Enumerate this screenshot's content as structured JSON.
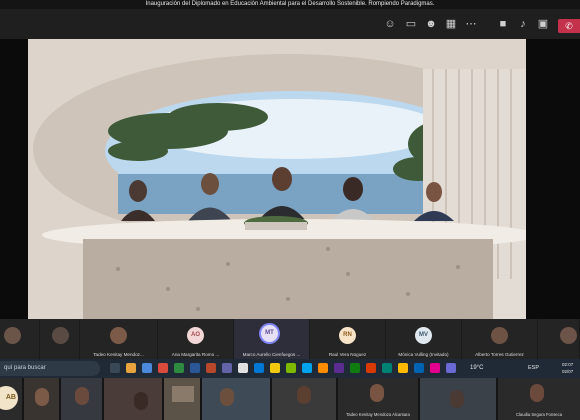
{
  "meeting": {
    "title": "Inauguración del Diplomado en Educación Ambiental para el Desarrollo Sostenible. Rompiendo Paradigmas."
  },
  "toolbar": {
    "icons": [
      "people-icon",
      "chat-icon",
      "reactions-icon",
      "view-icon",
      "share-icon",
      "more-icon",
      "camera-icon",
      "mic-icon",
      "share-screen-icon"
    ],
    "leave_color": "#c4314b"
  },
  "participants": [
    {
      "name": "",
      "initials": "",
      "kind": "photo"
    },
    {
      "name": "",
      "initials": "",
      "kind": "photo"
    },
    {
      "name": "Tadeo Kenitay Mendoz...",
      "initials": "",
      "kind": "photo"
    },
    {
      "name": "Ana Margarita Romo ...",
      "initials": "AO",
      "kind": "avatar",
      "color": "#f3d6d6",
      "text_color": "#a54a4a"
    },
    {
      "name": "Marco Aurelio Cienfuegos ...",
      "initials": "MT",
      "kind": "avatar",
      "color": "#e7e0f5",
      "text_color": "#5b4a9c",
      "active": true
    },
    {
      "name": "Raul Vera Noguez",
      "initials": "RN",
      "kind": "avatar",
      "color": "#f6e3c8",
      "text_color": "#8d5a1c"
    },
    {
      "name": "Mónica Vulling (Invitado)",
      "initials": "MV",
      "kind": "avatar",
      "color": "#dfe8ee",
      "text_color": "#3d5a70"
    },
    {
      "name": "Alberto Torres Gutierrez",
      "initials": "",
      "kind": "photo"
    },
    {
      "name": "",
      "initials": "",
      "kind": "photo"
    }
  ],
  "taskbar": {
    "search_placeholder": "quí para buscar",
    "weather": "19°C",
    "lang": "ESP",
    "time": "02:07",
    "date": "02/07"
  },
  "bottom": {
    "avatar_initials": "AB",
    "names": [
      "Tadeo Kenitay Mendoza Alcantara",
      "Claudia Segura Fonseca"
    ]
  }
}
